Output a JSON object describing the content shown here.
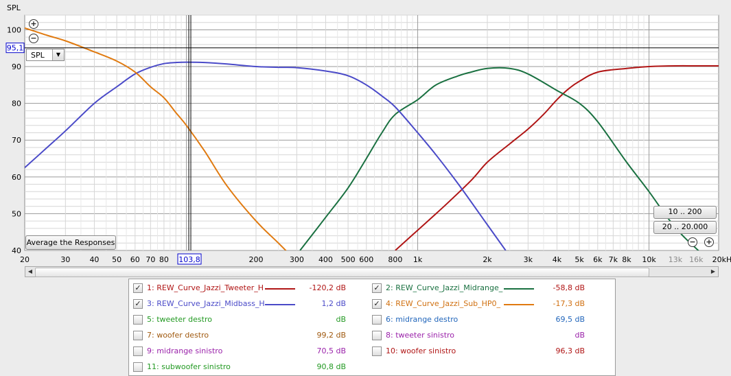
{
  "chart_data": {
    "type": "line",
    "ylabel": "SPL",
    "x_scale": "log",
    "xlim": [
      20,
      20000
    ],
    "ylim": [
      40,
      104
    ],
    "y_ticks": [
      40,
      50,
      60,
      70,
      80,
      90,
      100
    ],
    "x_ticks": [
      {
        "v": 20,
        "t": "20"
      },
      {
        "v": 30,
        "t": "30"
      },
      {
        "v": 40,
        "t": "40"
      },
      {
        "v": 50,
        "t": "50"
      },
      {
        "v": 60,
        "t": "60"
      },
      {
        "v": 70,
        "t": "70"
      },
      {
        "v": 80,
        "t": "80"
      },
      {
        "v": 200,
        "t": "200"
      },
      {
        "v": 300,
        "t": "300"
      },
      {
        "v": 400,
        "t": "400"
      },
      {
        "v": 500,
        "t": "500"
      },
      {
        "v": 600,
        "t": "600"
      },
      {
        "v": 800,
        "t": "800"
      },
      {
        "v": 1000,
        "t": "1k"
      },
      {
        "v": 2000,
        "t": "2k"
      },
      {
        "v": 3000,
        "t": "3k"
      },
      {
        "v": 4000,
        "t": "4k"
      },
      {
        "v": 5000,
        "t": "5k"
      },
      {
        "v": 6000,
        "t": "6k"
      },
      {
        "v": 7000,
        "t": "7k"
      },
      {
        "v": 8000,
        "t": "8k"
      },
      {
        "v": 10000,
        "t": "10k"
      },
      {
        "v": 13000,
        "t": "13k",
        "dim": true
      },
      {
        "v": 16000,
        "t": "16k",
        "dim": true
      },
      {
        "v": 20000,
        "t": "20kHz"
      }
    ],
    "grid": true,
    "cursor": {
      "x": 103.8,
      "x_label": "103,8",
      "y": 95.1,
      "y_label": "95,1"
    },
    "series": [
      {
        "name": "1: REW_Curve_Jazzi_Tweeter_H",
        "color": "#b01515",
        "x": [
          800,
          1000,
          1300,
          1700,
          2000,
          2500,
          3000,
          3500,
          4000,
          4500,
          5000,
          6000,
          8000,
          10000,
          13000,
          16000,
          20000
        ],
        "y": [
          40,
          45.5,
          52,
          59,
          64,
          69,
          73,
          77,
          81,
          84,
          86,
          88.5,
          89.5,
          90,
          90.2,
          90.2,
          90.2
        ]
      },
      {
        "name": "2: REW_Curve_Jazzi_Midrange_",
        "color": "#197040",
        "x": [
          310,
          400,
          500,
          600,
          700,
          800,
          1000,
          1200,
          1500,
          1700,
          2000,
          2500,
          3000,
          4000,
          5000,
          6000,
          8000,
          10000,
          12000,
          14000,
          17000
        ],
        "y": [
          40,
          49,
          57,
          65,
          72,
          77,
          81,
          85,
          87.5,
          88.5,
          89.5,
          89.5,
          88,
          83.5,
          80,
          75,
          64,
          56,
          49,
          44,
          39
        ]
      },
      {
        "name": "3: REW_Curve_Jazzi_Midbass_H",
        "color": "#4a4ac8",
        "x": [
          20,
          25,
          30,
          40,
          50,
          60,
          70,
          80,
          90,
          100,
          120,
          150,
          200,
          250,
          300,
          400,
          500,
          600,
          700,
          800,
          1000,
          1200,
          1500,
          2000,
          2400
        ],
        "y": [
          62.5,
          68,
          72.5,
          80,
          84.5,
          88,
          89.8,
          90.8,
          91.1,
          91.2,
          91.1,
          90.7,
          90,
          89.8,
          89.7,
          88.8,
          87.5,
          85,
          82,
          79,
          72,
          66,
          58,
          47,
          40
        ]
      },
      {
        "name": "4: REW_Curve_Jazzi_Sub_HP0_",
        "color": "#e07a10",
        "x": [
          20,
          25,
          30,
          40,
          50,
          60,
          70,
          80,
          90,
          100,
          120,
          150,
          200,
          250,
          300
        ],
        "y": [
          100.5,
          98.5,
          97,
          94,
          91.5,
          88.5,
          84.5,
          81.5,
          77.5,
          74,
          67,
          57.5,
          48,
          42,
          37
        ]
      }
    ]
  },
  "chart": {
    "axis_title": "SPL",
    "selector": "SPL",
    "average_button": "Average the Responses",
    "range_buttons": [
      "10 .. 200",
      "20 .. 20.000"
    ],
    "zoom_in_icon": "plus-circle-icon",
    "zoom_out_icon": "minus-circle-icon",
    "colors": {
      "plot_bg": "#ffffff",
      "grid_major": "#9a9a9a",
      "grid_minor": "#d6d6d6",
      "cursor": "#000000",
      "cursor_label": "#0000cc"
    }
  },
  "legend": {
    "items": [
      {
        "label": "1: REW_Curve_Jazzi_Tweeter_H",
        "value": "-120,2 dB",
        "checked": true,
        "text_color": "#b01515",
        "line_color": "#b01515",
        "value_color": "#b01515"
      },
      {
        "label": "2: REW_Curve_Jazzi_Midrange_",
        "value": "-58,8 dB",
        "checked": true,
        "text_color": "#197040",
        "line_color": "#197040",
        "value_color": "#b01515"
      },
      {
        "label": "3: REW_Curve_Jazzi_Midbass_H",
        "value": "1,2 dB",
        "checked": true,
        "text_color": "#4a4ac8",
        "line_color": "#4a4ac8",
        "value_color": "#4a4ac8"
      },
      {
        "label": "4: REW_Curve_Jazzi_Sub_HP0_",
        "value": "-17,3 dB",
        "checked": true,
        "text_color": "#d07010",
        "line_color": "#e07a10",
        "value_color": "#d07010"
      },
      {
        "label": "5: tweeter destro",
        "value": "dB",
        "checked": false,
        "text_color": "#229922",
        "line_color": "",
        "value_color": "#229922"
      },
      {
        "label": "6: midrange destro",
        "value": "69,5 dB",
        "checked": false,
        "text_color": "#2266bb",
        "line_color": "",
        "value_color": "#2266bb"
      },
      {
        "label": "7: woofer destro",
        "value": "99,2 dB",
        "checked": false,
        "text_color": "#a05a10",
        "line_color": "",
        "value_color": "#a05a10"
      },
      {
        "label": "8: tweeter sinistro",
        "value": "dB",
        "checked": false,
        "text_color": "#9a22aa",
        "line_color": "",
        "value_color": "#9a22aa"
      },
      {
        "label": "9: midrange sinistro",
        "value": "70,5 dB",
        "checked": false,
        "text_color": "#9a22aa",
        "line_color": "",
        "value_color": "#9a22aa"
      },
      {
        "label": "10: woofer sinistro",
        "value": "96,3 dB",
        "checked": false,
        "text_color": "#b01515",
        "line_color": "",
        "value_color": "#b01515"
      },
      {
        "label": "11: subwoofer sinistro",
        "value": "90,8 dB",
        "checked": false,
        "text_color": "#229922",
        "line_color": "",
        "value_color": "#229922"
      }
    ]
  }
}
